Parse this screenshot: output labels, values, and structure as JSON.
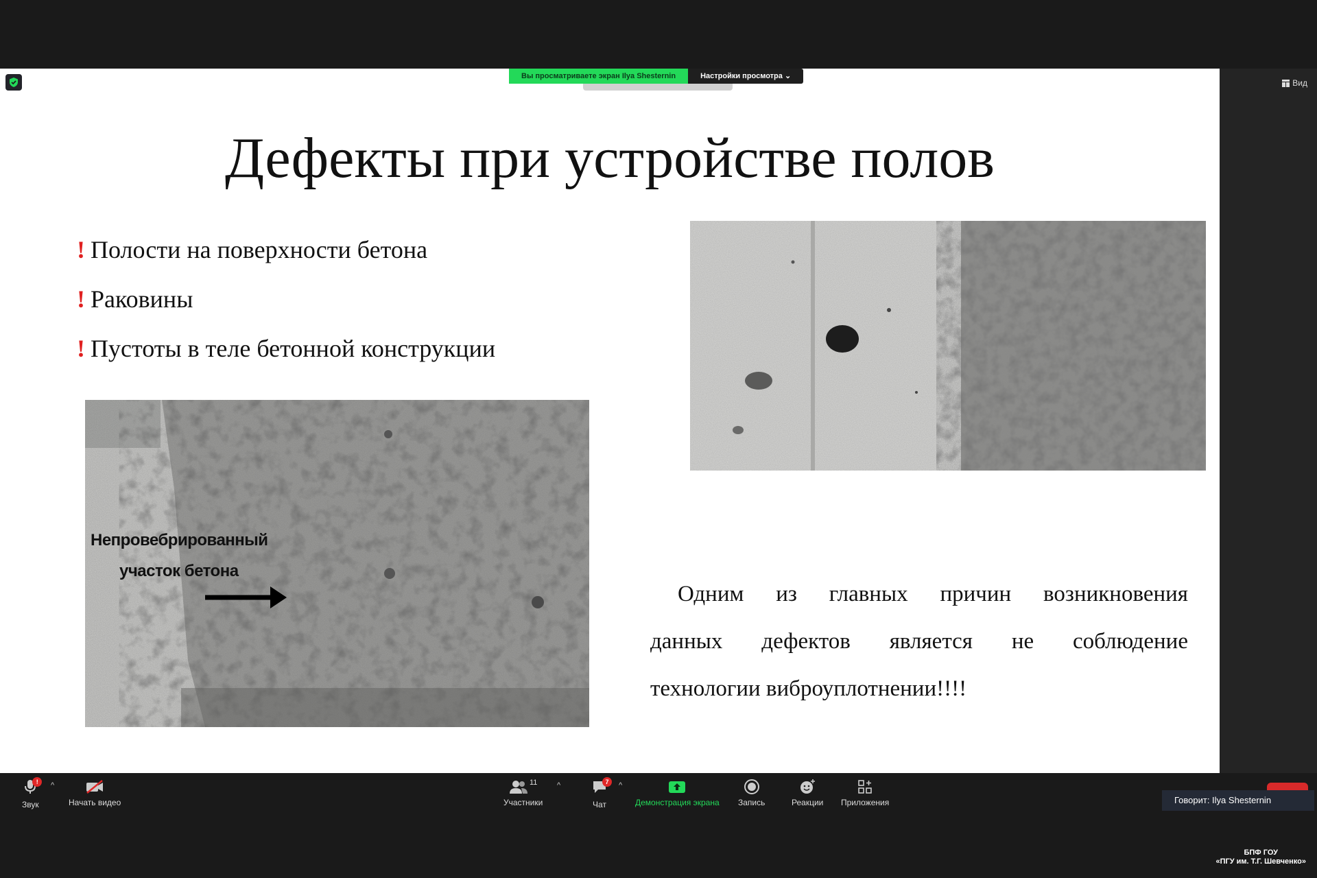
{
  "window": {
    "share_banner": "Вы просматриваете экран Ilya Shesternin",
    "view_options": "Настройки просмотра",
    "view_button": "Вид"
  },
  "slide": {
    "title": "Дефекты при устройстве полов",
    "bullet_mark": "!",
    "bullets": [
      "Полости на поверхности бетона",
      "Раковины",
      "Пустоты в теле бетонной конструкции"
    ],
    "photo_caption_line1": "Непровебрированный",
    "photo_caption_line2": "участок бетона",
    "paragraph": {
      "line1": [
        "Одним",
        "из",
        "главных",
        "причин",
        "возникновения"
      ],
      "line2": [
        "данных",
        "дефектов",
        "является",
        "не",
        "соблюдение"
      ],
      "line3": "технологии виброуплотнении!!!!"
    }
  },
  "toolbar": {
    "audio": "Звук",
    "video": "Начать видео",
    "participants": "Участники",
    "participants_count": "11",
    "chat": "Чат",
    "chat_badge": "7",
    "share": "Демонстрация экрана",
    "record": "Запись",
    "reactions": "Реакции",
    "apps": "Приложения",
    "audio_badge": "!"
  },
  "speaker": "Говорит: Ilya Shesternin",
  "watermark": {
    "line1": "БПФ ГОУ",
    "line2": "«ПГУ им. Т.Г. Шевченко»"
  },
  "colors": {
    "share_green": "#23d959",
    "accent_red": "#e02020"
  }
}
